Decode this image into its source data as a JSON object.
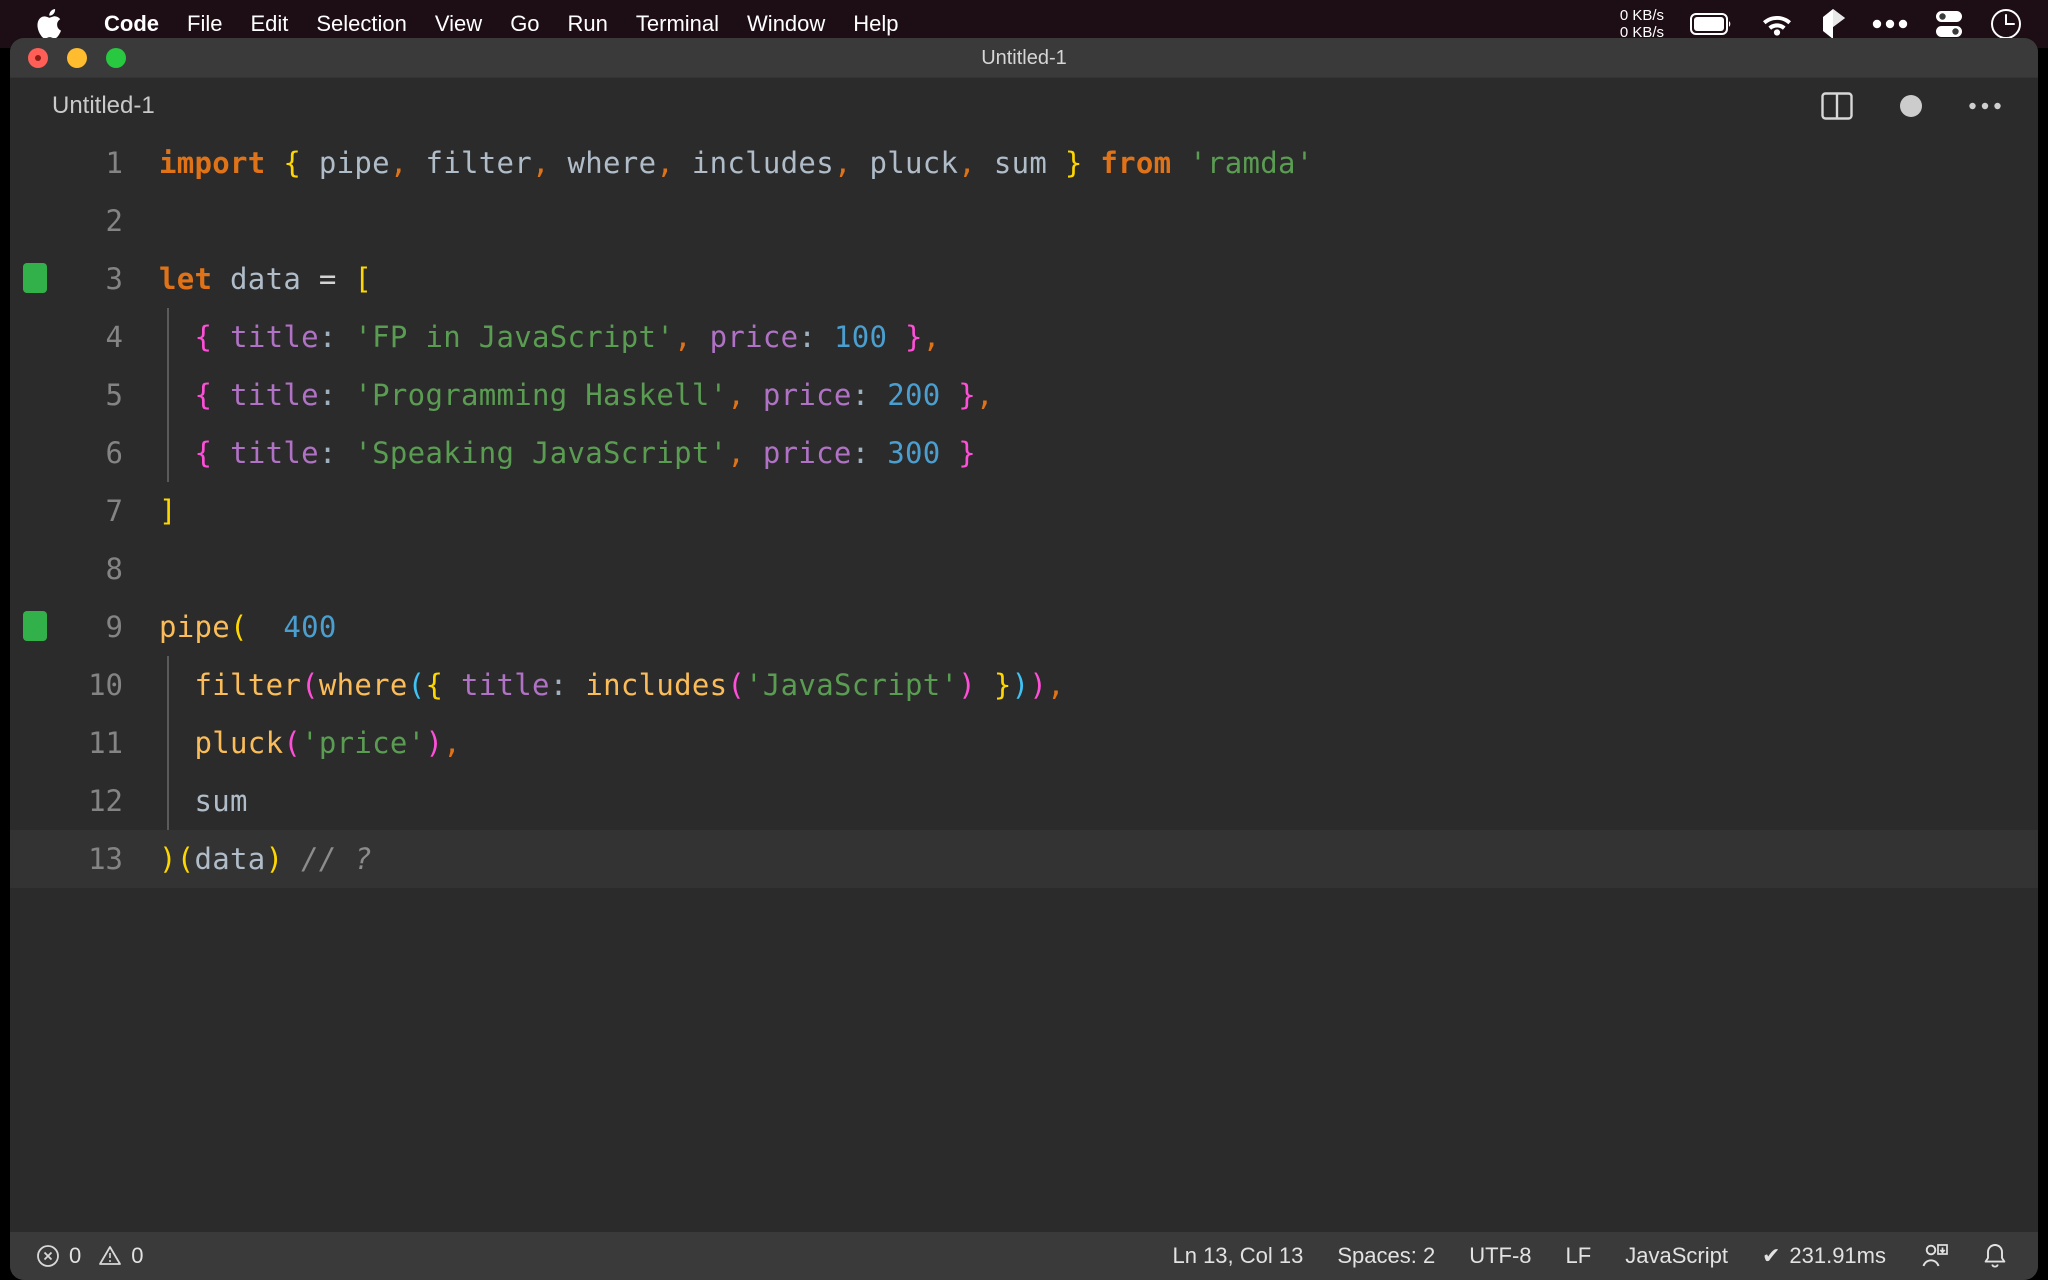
{
  "menubar": {
    "apple_icon": "apple-logo",
    "items": [
      {
        "label": "Code",
        "bold": true
      },
      {
        "label": "File",
        "bold": false
      },
      {
        "label": "Edit",
        "bold": false
      },
      {
        "label": "Selection",
        "bold": false
      },
      {
        "label": "View",
        "bold": false
      },
      {
        "label": "Go",
        "bold": false
      },
      {
        "label": "Run",
        "bold": false
      },
      {
        "label": "Terminal",
        "bold": false
      },
      {
        "label": "Window",
        "bold": false
      },
      {
        "label": "Help",
        "bold": false
      }
    ],
    "tray": {
      "net_up": "0 KB/s",
      "net_down": "0 KB/s",
      "icons": [
        "battery-icon",
        "wifi-icon",
        "dropbox-icon",
        "ellipsis-icon",
        "control-center-icon",
        "clock-icon"
      ]
    },
    "background": "#1d0d14"
  },
  "window": {
    "title": "Untitled-1",
    "traffic_lights": [
      "close-button",
      "minimize-button",
      "maximize-button"
    ],
    "colors": {
      "close": "#ff5f57",
      "minimize": "#febc2e",
      "maximize": "#28c840"
    }
  },
  "tab": {
    "label": "Untitled-1",
    "actions": [
      "split-editor-icon",
      "unsaved-dot-icon",
      "more-actions-icon"
    ]
  },
  "editor": {
    "language": "JavaScript",
    "active_line": 13,
    "gutter_marked_lines": [
      3,
      9
    ],
    "background": "#2b2b2b",
    "active_line_background": "#333333",
    "inlay_hint": "400",
    "lines": [
      {
        "n": 1,
        "text": "import { pipe, filter, where, includes, pluck, sum } from 'ramda'"
      },
      {
        "n": 2,
        "text": ""
      },
      {
        "n": 3,
        "text": "let data = ["
      },
      {
        "n": 4,
        "text": "  { title: 'FP in JavaScript', price: 100 },"
      },
      {
        "n": 5,
        "text": "  { title: 'Programming Haskell', price: 200 },"
      },
      {
        "n": 6,
        "text": "  { title: 'Speaking JavaScript', price: 300 }"
      },
      {
        "n": 7,
        "text": "]"
      },
      {
        "n": 8,
        "text": ""
      },
      {
        "n": 9,
        "text": "pipe("
      },
      {
        "n": 10,
        "text": "  filter(where({ title: includes('JavaScript') })),"
      },
      {
        "n": 11,
        "text": "  pluck('price'),"
      },
      {
        "n": 12,
        "text": "  sum"
      },
      {
        "n": 13,
        "text": ")(data) // ?"
      }
    ],
    "theme_colors": {
      "keyword": "#e07318",
      "string": "#5a9c52",
      "number": "#4a9fd0",
      "property": "#b072c4",
      "function": "#fbbd5a",
      "comment": "#8c8c8c",
      "variable": "#b0bdc9",
      "bracket_level_1": "#ffd700",
      "bracket_level_2": "#ff4fd8",
      "bracket_level_3": "#3fc2f5",
      "gutter_marker": "#32b14a"
    }
  },
  "statusbar": {
    "errors": "0",
    "warnings": "0",
    "cursor": "Ln 13, Col 13",
    "indentation": "Spaces: 2",
    "encoding": "UTF-8",
    "eol": "LF",
    "language": "JavaScript",
    "quokka_time": "231.91ms",
    "quokka_check": "✔",
    "right_icons": [
      "remote-account-icon",
      "notifications-bell-icon"
    ]
  }
}
